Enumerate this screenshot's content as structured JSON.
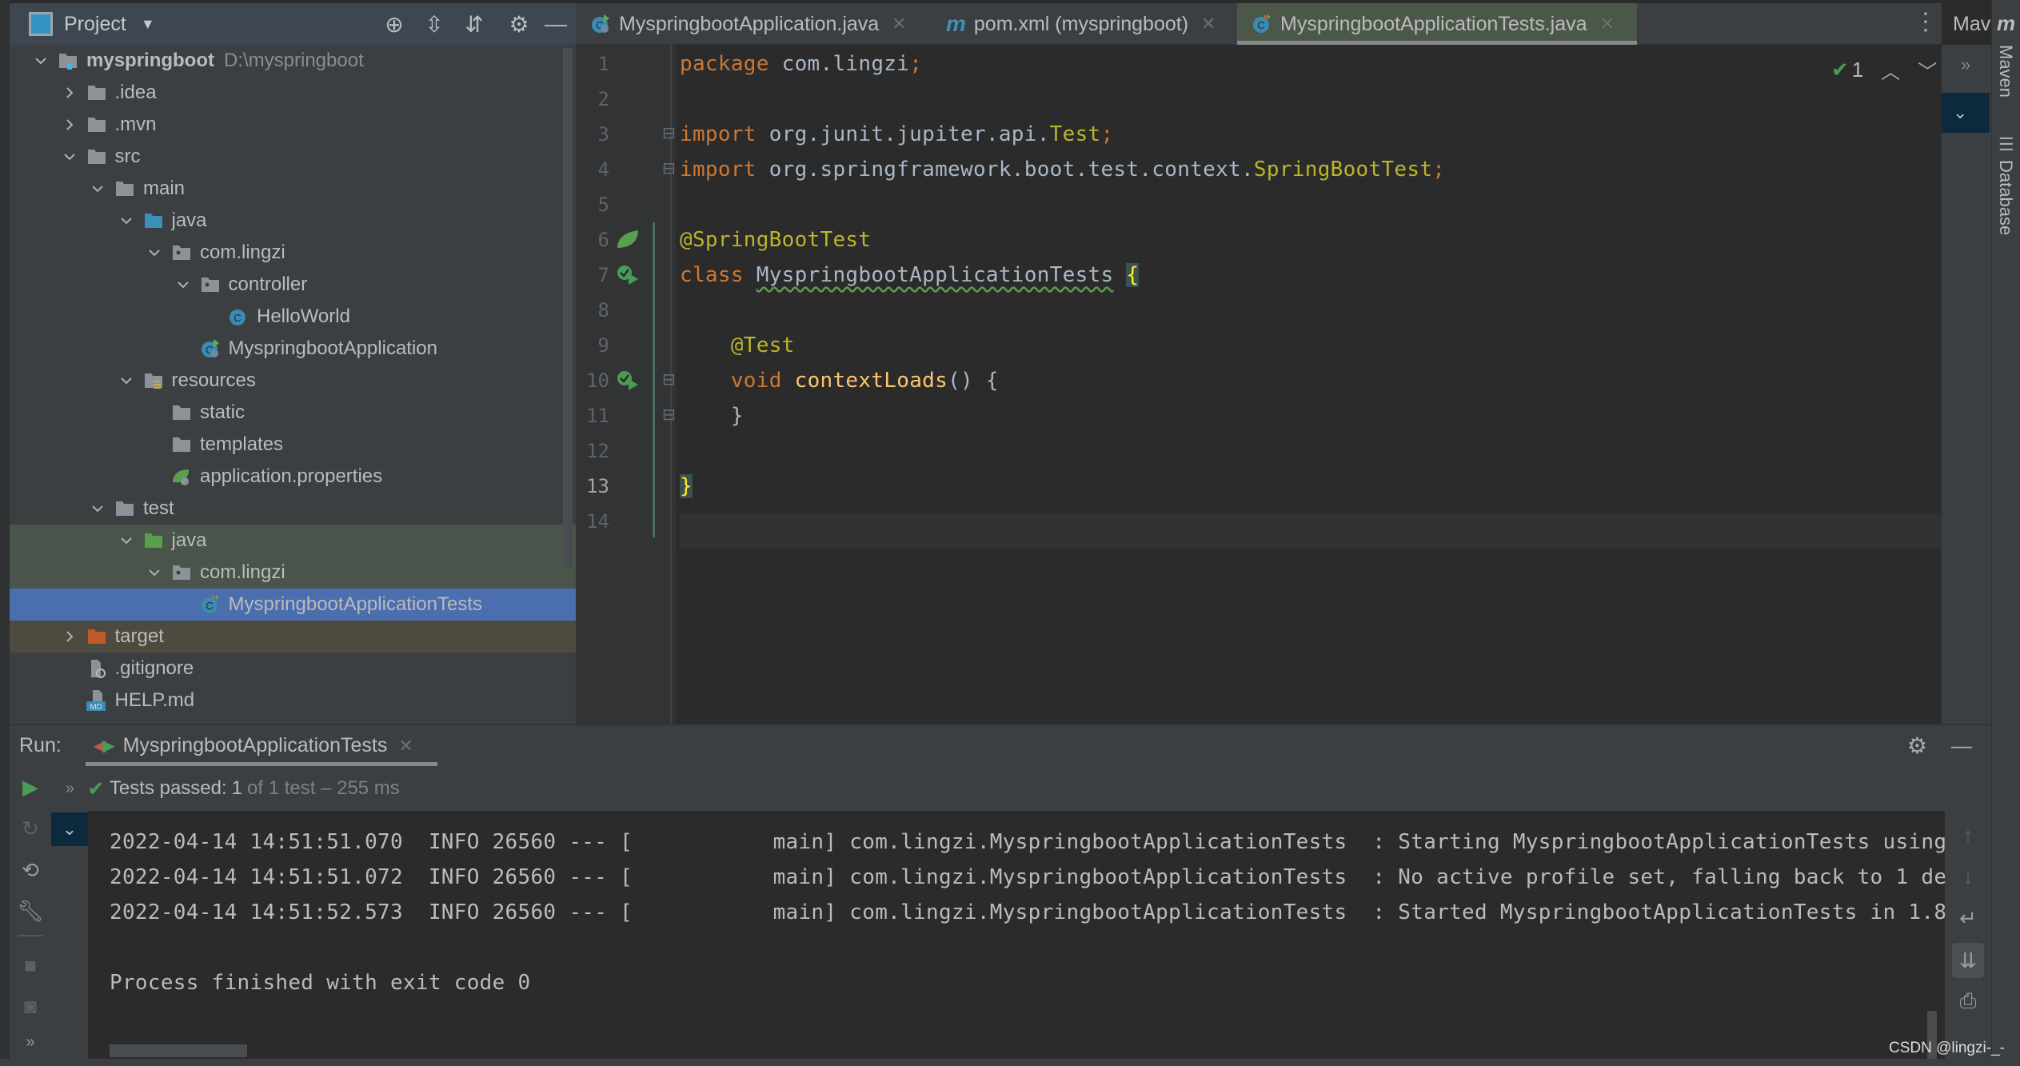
{
  "project_panel": {
    "title": "Project",
    "tree": [
      {
        "level": 0,
        "state": "open",
        "icon": "module",
        "label": "myspringboot",
        "secondary": "D:\\myspringboot",
        "bold": true
      },
      {
        "level": 1,
        "state": "closed",
        "icon": "folder",
        "label": ".idea"
      },
      {
        "level": 1,
        "state": "closed",
        "icon": "folder",
        "label": ".mvn"
      },
      {
        "level": 1,
        "state": "open",
        "icon": "folder",
        "label": "src"
      },
      {
        "level": 2,
        "state": "open",
        "icon": "folder",
        "label": "main"
      },
      {
        "level": 3,
        "state": "open",
        "icon": "source-folder",
        "label": "java"
      },
      {
        "level": 4,
        "state": "open",
        "icon": "package",
        "label": "com.lingzi"
      },
      {
        "level": 5,
        "state": "open",
        "icon": "package",
        "label": "controller"
      },
      {
        "level": 6,
        "state": "leaf",
        "icon": "class",
        "label": "HelloWorld"
      },
      {
        "level": 5,
        "state": "leaf",
        "icon": "spring-class",
        "label": "MyspringbootApplication"
      },
      {
        "level": 3,
        "state": "open",
        "icon": "resources-folder",
        "label": "resources"
      },
      {
        "level": 4,
        "state": "leaf",
        "icon": "folder",
        "label": "static"
      },
      {
        "level": 4,
        "state": "leaf",
        "icon": "folder",
        "label": "templates"
      },
      {
        "level": 4,
        "state": "leaf",
        "icon": "spring-properties",
        "label": "application.properties"
      },
      {
        "level": 2,
        "state": "open",
        "icon": "folder",
        "label": "test"
      },
      {
        "level": 3,
        "state": "open",
        "icon": "test-folder",
        "label": "java",
        "highlight": "test"
      },
      {
        "level": 4,
        "state": "open",
        "icon": "package",
        "label": "com.lingzi",
        "highlight": "test"
      },
      {
        "level": 5,
        "state": "leaf",
        "icon": "test-class",
        "label": "MyspringbootApplicationTests",
        "highlight": "selected"
      },
      {
        "level": 1,
        "state": "closed",
        "icon": "excluded-folder",
        "label": "target",
        "highlight": "excluded"
      },
      {
        "level": 1,
        "state": "leaf",
        "icon": "ignore-file",
        "label": ".gitignore"
      },
      {
        "level": 1,
        "state": "leaf",
        "icon": "markdown-file",
        "label": "HELP.md"
      }
    ]
  },
  "editor_tabs": [
    {
      "label": "MyspringbootApplication.java",
      "icon": "spring-class",
      "active": false
    },
    {
      "label": "pom.xml (myspringboot)",
      "icon": "maven",
      "active": false
    },
    {
      "label": "MyspringbootApplicationTests.java",
      "icon": "test-class",
      "active": true
    }
  ],
  "maven_tab_label": "Mav",
  "inspection": {
    "count": "1"
  },
  "code": [
    [
      [
        "package ",
        "k"
      ],
      [
        "com.lingzi",
        "p"
      ],
      [
        ";",
        "k"
      ]
    ],
    [],
    [
      [
        "import ",
        "k"
      ],
      [
        "org.junit.jupiter.api.",
        "p"
      ],
      [
        "Test",
        "t"
      ],
      [
        ";",
        "k"
      ]
    ],
    [
      [
        "import ",
        "k"
      ],
      [
        "org.springframework.boot.test.context.",
        "p"
      ],
      [
        "SpringBootTest",
        "t"
      ],
      [
        ";",
        "k"
      ]
    ],
    [],
    [
      [
        "@SpringBootTest",
        "a"
      ]
    ],
    [
      [
        "class ",
        "k"
      ],
      [
        "MyspringbootApplicationTests",
        "pu"
      ],
      [
        " ",
        "p"
      ],
      [
        "{",
        "b"
      ]
    ],
    [],
    [
      [
        "    ",
        "p"
      ],
      [
        "@Test",
        "a"
      ]
    ],
    [
      [
        "    ",
        "p"
      ],
      [
        "void ",
        "k"
      ],
      [
        "contextLoads",
        "m"
      ],
      [
        "() {",
        "p"
      ]
    ],
    [
      [
        "    }",
        "p"
      ]
    ],
    [],
    [
      [
        "}",
        "b"
      ]
    ],
    []
  ],
  "gutter_icons": {
    "6": "spring-bean",
    "7": "run-test",
    "10": "run-test"
  },
  "right_toolbar": {
    "maven": "Maven",
    "database": "Database"
  },
  "run_panel": {
    "label": "Run:",
    "tab": "MyspringbootApplicationTests",
    "status_prefix": "Tests passed:",
    "status_count": "1",
    "status_rest": "of 1 test – 255 ms",
    "console": [
      "2022-04-14 14:51:51.070  INFO 26560 --- [           main] com.lingzi.MyspringbootApplicationTests  : Starting MyspringbootApplicationTests using",
      "2022-04-14 14:51:51.072  INFO 26560 --- [           main] com.lingzi.MyspringbootApplicationTests  : No active profile set, falling back to 1 de",
      "2022-04-14 14:51:52.573  INFO 26560 --- [           main] com.lingzi.MyspringbootApplicationTests  : Started MyspringbootApplicationTests in 1.8",
      "",
      "Process finished with exit code 0"
    ]
  },
  "watermark": "CSDN @lingzi-_-",
  "colors": {
    "selection": "#4b6eaf",
    "test_row": "#49544a",
    "excluded_row": "#4d4a3f",
    "accent_green": "#499c54"
  }
}
